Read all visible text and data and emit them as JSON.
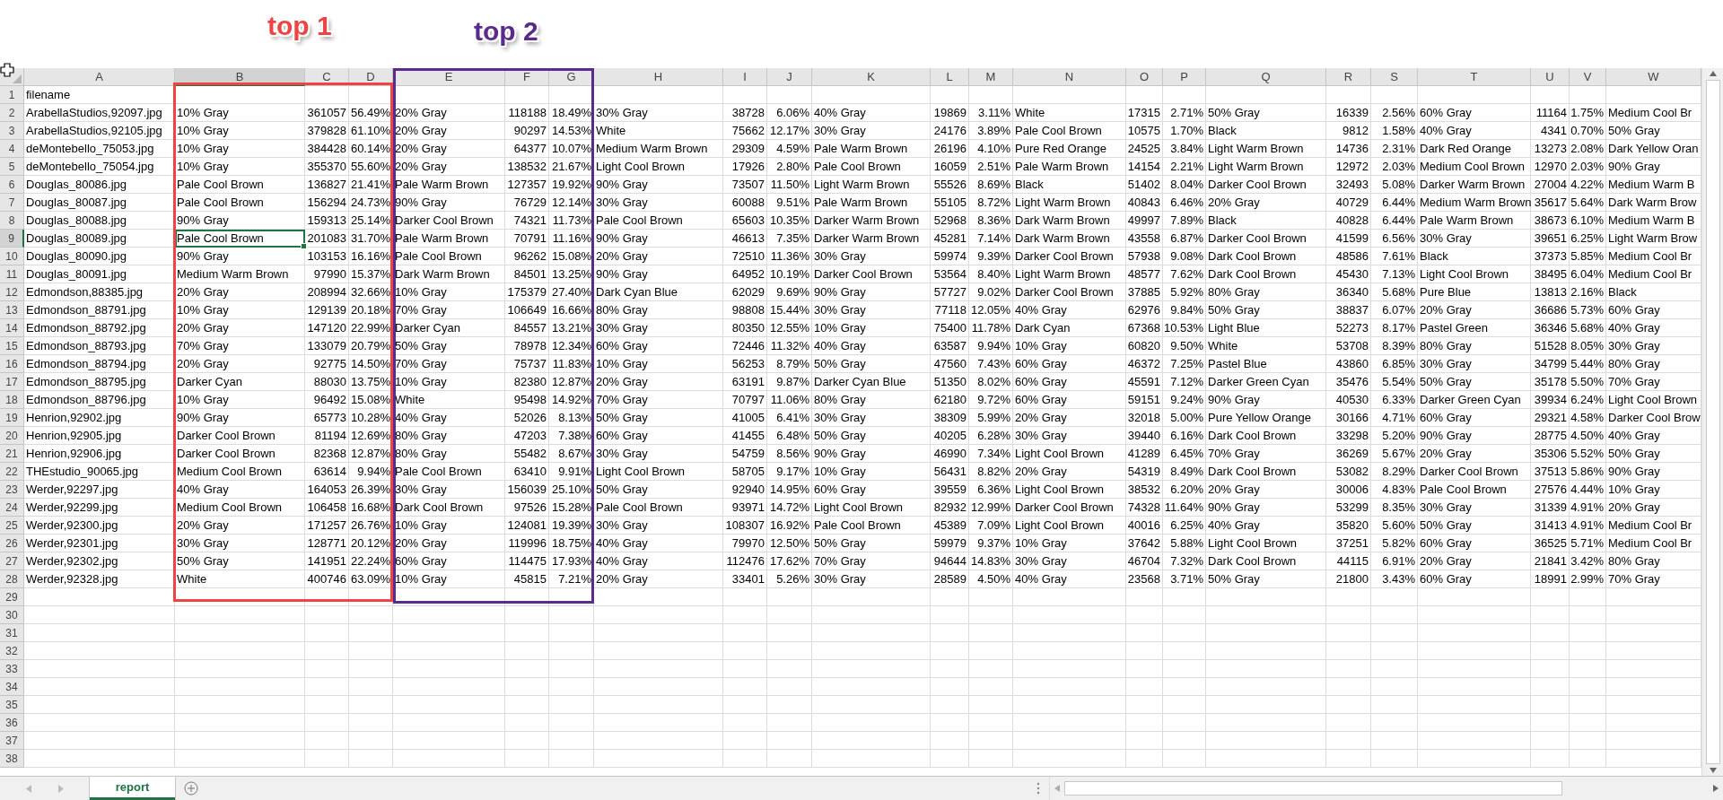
{
  "annotations": [
    {
      "label": "top 1",
      "color": "#ee4444"
    },
    {
      "label": "top 2",
      "color": "#5b2b8c"
    }
  ],
  "columns": [
    {
      "letter": "A",
      "kind": "text",
      "selected": false
    },
    {
      "letter": "B",
      "kind": "text",
      "selected": true
    },
    {
      "letter": "C",
      "kind": "number",
      "selected": false
    },
    {
      "letter": "D",
      "kind": "number",
      "selected": false
    },
    {
      "letter": "E",
      "kind": "text",
      "selected": false
    },
    {
      "letter": "F",
      "kind": "number",
      "selected": false
    },
    {
      "letter": "G",
      "kind": "number",
      "selected": false
    },
    {
      "letter": "H",
      "kind": "text",
      "selected": false
    },
    {
      "letter": "I",
      "kind": "number",
      "selected": false
    },
    {
      "letter": "J",
      "kind": "number",
      "selected": false
    },
    {
      "letter": "K",
      "kind": "text",
      "selected": false
    },
    {
      "letter": "L",
      "kind": "number",
      "selected": false
    },
    {
      "letter": "M",
      "kind": "number",
      "selected": false
    },
    {
      "letter": "N",
      "kind": "text",
      "selected": false
    },
    {
      "letter": "O",
      "kind": "number",
      "selected": false
    },
    {
      "letter": "P",
      "kind": "number",
      "selected": false
    },
    {
      "letter": "Q",
      "kind": "text",
      "selected": false
    },
    {
      "letter": "R",
      "kind": "number",
      "selected": false
    },
    {
      "letter": "S",
      "kind": "number",
      "selected": false
    },
    {
      "letter": "T",
      "kind": "text",
      "selected": false
    },
    {
      "letter": "U",
      "kind": "number",
      "selected": false
    },
    {
      "letter": "V",
      "kind": "number",
      "selected": false
    },
    {
      "letter": "W",
      "kind": "text",
      "selected": false
    }
  ],
  "rows": [
    {
      "number": "1",
      "selected": false,
      "cells": [
        "filename"
      ]
    },
    {
      "number": "2",
      "selected": false,
      "cells": [
        "ArabellaStudios,92097.jpg",
        "10% Gray",
        "361057",
        "56.49%",
        "20% Gray",
        "118188",
        "18.49%",
        "30% Gray",
        "38728",
        "6.06%",
        "40% Gray",
        "19869",
        "3.11%",
        "White",
        "17315",
        "2.71%",
        "50% Gray",
        "16339",
        "2.56%",
        "60% Gray",
        "11164",
        "1.75%",
        "Medium Cool Br"
      ]
    },
    {
      "number": "3",
      "selected": false,
      "cells": [
        "ArabellaStudios,92105.jpg",
        "10% Gray",
        "379828",
        "61.10%",
        "20% Gray",
        "90297",
        "14.53%",
        "White",
        "75662",
        "12.17%",
        "30% Gray",
        "24176",
        "3.89%",
        "Pale Cool Brown",
        "10575",
        "1.70%",
        "Black",
        "9812",
        "1.58%",
        "40% Gray",
        "4341",
        "0.70%",
        "50% Gray"
      ]
    },
    {
      "number": "4",
      "selected": false,
      "cells": [
        "deMontebello_75053.jpg",
        "10% Gray",
        "384428",
        "60.14%",
        "20% Gray",
        "64377",
        "10.07%",
        "Medium Warm Brown",
        "29309",
        "4.59%",
        "Pale Warm Brown",
        "26196",
        "4.10%",
        "Pure Red Orange",
        "24525",
        "3.84%",
        "Light Warm Brown",
        "14736",
        "2.31%",
        "Dark Red Orange",
        "13273",
        "2.08%",
        "Dark Yellow Oran"
      ]
    },
    {
      "number": "5",
      "selected": false,
      "cells": [
        "deMontebello_75054.jpg",
        "10% Gray",
        "355370",
        "55.60%",
        "20% Gray",
        "138532",
        "21.67%",
        "Light Cool Brown",
        "17926",
        "2.80%",
        "Pale Cool Brown",
        "16059",
        "2.51%",
        "Pale Warm Brown",
        "14154",
        "2.21%",
        "Light Warm Brown",
        "12972",
        "2.03%",
        "Medium Cool Brown",
        "12970",
        "2.03%",
        "90% Gray"
      ]
    },
    {
      "number": "6",
      "selected": false,
      "cells": [
        "Douglas_80086.jpg",
        "Pale Cool Brown",
        "136827",
        "21.41%",
        "Pale Warm Brown",
        "127357",
        "19.92%",
        "90% Gray",
        "73507",
        "11.50%",
        "Light Warm Brown",
        "55526",
        "8.69%",
        "Black",
        "51402",
        "8.04%",
        "Darker Cool Brown",
        "32493",
        "5.08%",
        "Darker Warm Brown",
        "27004",
        "4.22%",
        "Medium Warm B"
      ]
    },
    {
      "number": "7",
      "selected": false,
      "cells": [
        "Douglas_80087.jpg",
        "Pale Cool Brown",
        "156294",
        "24.73%",
        "90% Gray",
        "76729",
        "12.14%",
        "30% Gray",
        "60088",
        "9.51%",
        "Pale Warm Brown",
        "55105",
        "8.72%",
        "Light Warm Brown",
        "40843",
        "6.46%",
        "20% Gray",
        "40729",
        "6.44%",
        "Medium Warm Brown",
        "35617",
        "5.64%",
        "Dark Warm Brow"
      ]
    },
    {
      "number": "8",
      "selected": false,
      "cells": [
        "Douglas_80088.jpg",
        "90% Gray",
        "159313",
        "25.14%",
        "Darker Cool Brown",
        "74321",
        "11.73%",
        "Pale Cool Brown",
        "65603",
        "10.35%",
        "Darker Warm Brown",
        "52968",
        "8.36%",
        "Dark Warm Brown",
        "49997",
        "7.89%",
        "Black",
        "40828",
        "6.44%",
        "Pale Warm Brown",
        "38673",
        "6.10%",
        "Medium Warm B"
      ]
    },
    {
      "number": "9",
      "selected": true,
      "cells": [
        "Douglas_80089.jpg",
        "Pale Cool Brown",
        "201083",
        "31.70%",
        "Pale Warm Brown",
        "70791",
        "11.16%",
        "90% Gray",
        "46613",
        "7.35%",
        "Darker Warm Brown",
        "45281",
        "7.14%",
        "Dark Warm Brown",
        "43558",
        "6.87%",
        "Darker Cool Brown",
        "41599",
        "6.56%",
        "30% Gray",
        "39651",
        "6.25%",
        "Light Warm Brow"
      ]
    },
    {
      "number": "10",
      "selected": false,
      "cells": [
        "Douglas_80090.jpg",
        "90% Gray",
        "103153",
        "16.16%",
        "Pale Cool Brown",
        "96262",
        "15.08%",
        "20% Gray",
        "72510",
        "11.36%",
        "30% Gray",
        "59974",
        "9.39%",
        "Darker Cool Brown",
        "57938",
        "9.08%",
        "Dark Cool Brown",
        "48586",
        "7.61%",
        "Black",
        "37373",
        "5.85%",
        "Medium Cool Br"
      ]
    },
    {
      "number": "11",
      "selected": false,
      "cells": [
        "Douglas_80091.jpg",
        "Medium Warm Brown",
        "97990",
        "15.37%",
        "Dark Warm Brown",
        "84501",
        "13.25%",
        "90% Gray",
        "64952",
        "10.19%",
        "Darker Cool Brown",
        "53564",
        "8.40%",
        "Light Warm Brown",
        "48577",
        "7.62%",
        "Dark Cool Brown",
        "45430",
        "7.13%",
        "Light Cool Brown",
        "38495",
        "6.04%",
        "Medium Cool Br"
      ]
    },
    {
      "number": "12",
      "selected": false,
      "cells": [
        "Edmondson,88385.jpg",
        "20% Gray",
        "208994",
        "32.66%",
        "10% Gray",
        "175379",
        "27.40%",
        "Dark Cyan Blue",
        "62029",
        "9.69%",
        "90% Gray",
        "57727",
        "9.02%",
        "Darker Cool Brown",
        "37885",
        "5.92%",
        "80% Gray",
        "36340",
        "5.68%",
        "Pure Blue",
        "13813",
        "2.16%",
        "Black"
      ]
    },
    {
      "number": "13",
      "selected": false,
      "cells": [
        "Edmondson_88791.jpg",
        "10% Gray",
        "129139",
        "20.18%",
        "70% Gray",
        "106649",
        "16.66%",
        "80% Gray",
        "98808",
        "15.44%",
        "30% Gray",
        "77118",
        "12.05%",
        "40% Gray",
        "62976",
        "9.84%",
        "50% Gray",
        "38837",
        "6.07%",
        "20% Gray",
        "36686",
        "5.73%",
        "60% Gray"
      ]
    },
    {
      "number": "14",
      "selected": false,
      "cells": [
        "Edmondson_88792.jpg",
        "20% Gray",
        "147120",
        "22.99%",
        "Darker Cyan",
        "84557",
        "13.21%",
        "30% Gray",
        "80350",
        "12.55%",
        "10% Gray",
        "75400",
        "11.78%",
        "Dark Cyan",
        "67368",
        "10.53%",
        "Light Blue",
        "52273",
        "8.17%",
        "Pastel Green",
        "36346",
        "5.68%",
        "40% Gray"
      ]
    },
    {
      "number": "15",
      "selected": false,
      "cells": [
        "Edmondson_88793.jpg",
        "70% Gray",
        "133079",
        "20.79%",
        "50% Gray",
        "78978",
        "12.34%",
        "60% Gray",
        "72446",
        "11.32%",
        "40% Gray",
        "63587",
        "9.94%",
        "10% Gray",
        "60820",
        "9.50%",
        "White",
        "53708",
        "8.39%",
        "80% Gray",
        "51528",
        "8.05%",
        "30% Gray"
      ]
    },
    {
      "number": "16",
      "selected": false,
      "cells": [
        "Edmondson_88794.jpg",
        "20% Gray",
        "92775",
        "14.50%",
        "70% Gray",
        "75737",
        "11.83%",
        "10% Gray",
        "56253",
        "8.79%",
        "50% Gray",
        "47560",
        "7.43%",
        "60% Gray",
        "46372",
        "7.25%",
        "Pastel Blue",
        "43860",
        "6.85%",
        "30% Gray",
        "34799",
        "5.44%",
        "80% Gray"
      ]
    },
    {
      "number": "17",
      "selected": false,
      "cells": [
        "Edmondson_88795.jpg",
        "Darker Cyan",
        "88030",
        "13.75%",
        "10% Gray",
        "82380",
        "12.87%",
        "20% Gray",
        "63191",
        "9.87%",
        "Darker Cyan Blue",
        "51350",
        "8.02%",
        "60% Gray",
        "45591",
        "7.12%",
        "Darker Green Cyan",
        "35476",
        "5.54%",
        "50% Gray",
        "35178",
        "5.50%",
        "70% Gray"
      ]
    },
    {
      "number": "18",
      "selected": false,
      "cells": [
        "Edmondson_88796.jpg",
        "10% Gray",
        "96492",
        "15.08%",
        "White",
        "95498",
        "14.92%",
        "70% Gray",
        "70797",
        "11.06%",
        "80% Gray",
        "62180",
        "9.72%",
        "60% Gray",
        "59151",
        "9.24%",
        "90% Gray",
        "40530",
        "6.33%",
        "Darker Green Cyan",
        "39934",
        "6.24%",
        "Light Cool Brown"
      ]
    },
    {
      "number": "19",
      "selected": false,
      "cells": [
        "Henrion,92902.jpg",
        "90% Gray",
        "65773",
        "10.28%",
        "40% Gray",
        "52026",
        "8.13%",
        "50% Gray",
        "41005",
        "6.41%",
        "30% Gray",
        "38309",
        "5.99%",
        "20% Gray",
        "32018",
        "5.00%",
        "Pure Yellow Orange",
        "30166",
        "4.71%",
        "60% Gray",
        "29321",
        "4.58%",
        "Darker Cool Brow"
      ]
    },
    {
      "number": "20",
      "selected": false,
      "cells": [
        "Henrion,92905.jpg",
        "Darker Cool Brown",
        "81194",
        "12.69%",
        "80% Gray",
        "47203",
        "7.38%",
        "60% Gray",
        "41455",
        "6.48%",
        "50% Gray",
        "40205",
        "6.28%",
        "30% Gray",
        "39440",
        "6.16%",
        "Dark Cool Brown",
        "33298",
        "5.20%",
        "90% Gray",
        "28775",
        "4.50%",
        "40% Gray"
      ]
    },
    {
      "number": "21",
      "selected": false,
      "cells": [
        "Henrion,92906.jpg",
        "Darker Cool Brown",
        "82368",
        "12.87%",
        "80% Gray",
        "55482",
        "8.67%",
        "30% Gray",
        "54759",
        "8.56%",
        "90% Gray",
        "46990",
        "7.34%",
        "Light Cool Brown",
        "41289",
        "6.45%",
        "70% Gray",
        "36269",
        "5.67%",
        "20% Gray",
        "35306",
        "5.52%",
        "50% Gray"
      ]
    },
    {
      "number": "22",
      "selected": false,
      "cells": [
        "THEstudio_90065.jpg",
        "Medium Cool Brown",
        "63614",
        "9.94%",
        "Pale Cool Brown",
        "63410",
        "9.91%",
        "Light Cool Brown",
        "58705",
        "9.17%",
        "10% Gray",
        "56431",
        "8.82%",
        "20% Gray",
        "54319",
        "8.49%",
        "Dark Cool Brown",
        "53082",
        "8.29%",
        "Darker Cool Brown",
        "37513",
        "5.86%",
        "90% Gray"
      ]
    },
    {
      "number": "23",
      "selected": false,
      "cells": [
        "Werder,92297.jpg",
        "40% Gray",
        "164053",
        "26.39%",
        "30% Gray",
        "156039",
        "25.10%",
        "50% Gray",
        "92940",
        "14.95%",
        "60% Gray",
        "39559",
        "6.36%",
        "Light Cool Brown",
        "38532",
        "6.20%",
        "20% Gray",
        "30006",
        "4.83%",
        "Pale Cool Brown",
        "27576",
        "4.44%",
        "10% Gray"
      ]
    },
    {
      "number": "24",
      "selected": false,
      "cells": [
        "Werder,92299.jpg",
        "Medium Cool Brown",
        "106458",
        "16.68%",
        "Dark Cool Brown",
        "97526",
        "15.28%",
        "Pale Cool Brown",
        "93971",
        "14.72%",
        "Light Cool Brown",
        "82932",
        "12.99%",
        "Darker Cool Brown",
        "74328",
        "11.64%",
        "90% Gray",
        "53299",
        "8.35%",
        "30% Gray",
        "31339",
        "4.91%",
        "20% Gray"
      ]
    },
    {
      "number": "25",
      "selected": false,
      "cells": [
        "Werder,92300.jpg",
        "20% Gray",
        "171257",
        "26.76%",
        "10% Gray",
        "124081",
        "19.39%",
        "30% Gray",
        "108307",
        "16.92%",
        "Pale Cool Brown",
        "45389",
        "7.09%",
        "Light Cool Brown",
        "40016",
        "6.25%",
        "40% Gray",
        "35820",
        "5.60%",
        "50% Gray",
        "31413",
        "4.91%",
        "Medium Cool Br"
      ]
    },
    {
      "number": "26",
      "selected": false,
      "cells": [
        "Werder,92301.jpg",
        "30% Gray",
        "128771",
        "20.12%",
        "20% Gray",
        "119996",
        "18.75%",
        "40% Gray",
        "79970",
        "12.50%",
        "50% Gray",
        "59979",
        "9.37%",
        "10% Gray",
        "37642",
        "5.88%",
        "Light Cool Brown",
        "37251",
        "5.82%",
        "60% Gray",
        "36525",
        "5.71%",
        "Medium Cool Br"
      ]
    },
    {
      "number": "27",
      "selected": false,
      "cells": [
        "Werder,92302.jpg",
        "50% Gray",
        "141951",
        "22.24%",
        "60% Gray",
        "114475",
        "17.93%",
        "40% Gray",
        "112476",
        "17.62%",
        "70% Gray",
        "94644",
        "14.83%",
        "30% Gray",
        "46704",
        "7.32%",
        "Dark Cool Brown",
        "44115",
        "6.91%",
        "20% Gray",
        "21841",
        "3.42%",
        "80% Gray"
      ]
    },
    {
      "number": "28",
      "selected": false,
      "cells": [
        "Werder,92328.jpg",
        "White",
        "400746",
        "63.09%",
        "10% Gray",
        "45815",
        "7.21%",
        "20% Gray",
        "33401",
        "5.26%",
        "30% Gray",
        "28589",
        "4.50%",
        "40% Gray",
        "23568",
        "3.71%",
        "50% Gray",
        "21800",
        "3.43%",
        "60% Gray",
        "18991",
        "2.99%",
        "70% Gray"
      ]
    },
    {
      "number": "29",
      "selected": false
    },
    {
      "number": "30",
      "selected": false
    },
    {
      "number": "31",
      "selected": false
    },
    {
      "number": "32",
      "selected": false
    },
    {
      "number": "33",
      "selected": false
    },
    {
      "number": "34",
      "selected": false
    },
    {
      "number": "35",
      "selected": false
    },
    {
      "number": "36",
      "selected": false
    },
    {
      "number": "37",
      "selected": false
    },
    {
      "number": "38",
      "selected": false
    }
  ],
  "sheet_tabs": [
    {
      "label": "report",
      "selected": true
    }
  ]
}
